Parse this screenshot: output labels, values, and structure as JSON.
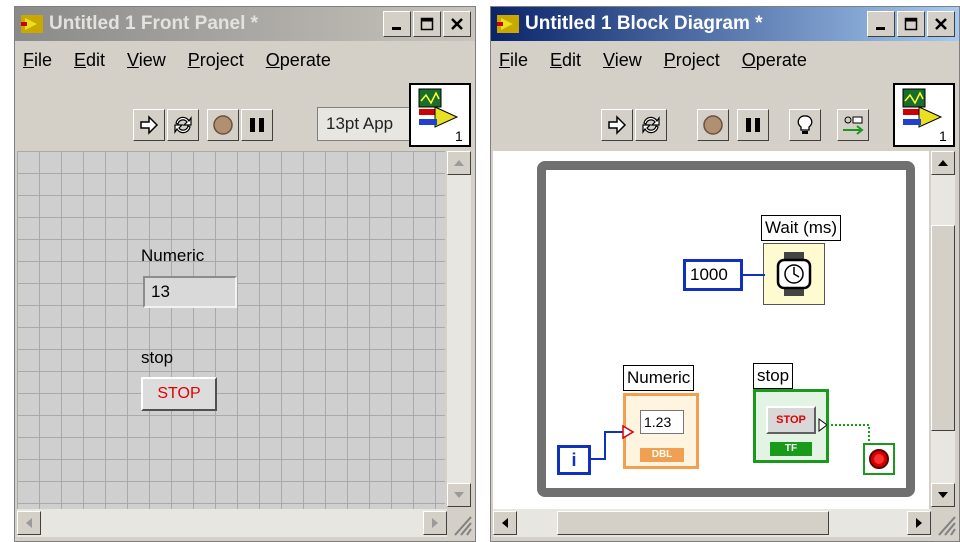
{
  "front_panel": {
    "title": "Untitled 1 Front Panel *",
    "menu": [
      {
        "key": "F",
        "rest": "ile"
      },
      {
        "key": "E",
        "rest": "dit"
      },
      {
        "key": "V",
        "rest": "iew"
      },
      {
        "key": "P",
        "rest": "roject"
      },
      {
        "key": "O",
        "rest": "perate"
      }
    ],
    "font_selector": "13pt App",
    "numeric_label": "Numeric",
    "numeric_value": "13",
    "stop_label": "stop",
    "stop_button_text": "STOP",
    "connector_number": "1"
  },
  "block_diagram": {
    "title": "Untitled 1 Block Diagram *",
    "menu": [
      {
        "key": "F",
        "rest": "ile"
      },
      {
        "key": "E",
        "rest": "dit"
      },
      {
        "key": "V",
        "rest": "iew"
      },
      {
        "key": "P",
        "rest": "roject"
      },
      {
        "key": "O",
        "rest": "perate"
      }
    ],
    "wait_label": "Wait (ms)",
    "wait_constant": "1000",
    "numeric_label": "Numeric",
    "numeric_indicator_value": "1.23",
    "numeric_type": "DBL",
    "stop_label": "stop",
    "stop_control_text": "STOP",
    "stop_type": "TF",
    "iteration_terminal": "i",
    "connector_number": "1"
  }
}
